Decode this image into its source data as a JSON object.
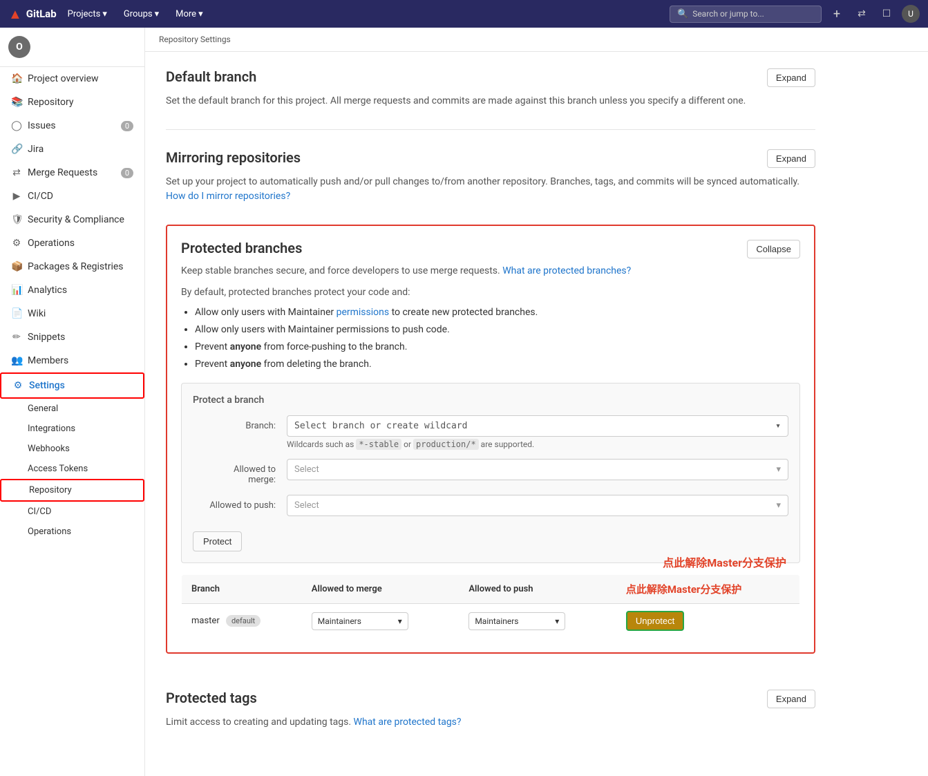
{
  "topnav": {
    "logo_text": "GitLab",
    "nav_items": [
      "Projects",
      "Groups",
      "More"
    ],
    "search_placeholder": "Search or jump to...",
    "icons": [
      "plus-icon",
      "merge-icon",
      "todo-icon",
      "user-icon"
    ]
  },
  "sidebar": {
    "avatar_initial": "O",
    "project_name": "",
    "items": [
      {
        "id": "project-overview",
        "label": "Project overview",
        "icon": "home-icon"
      },
      {
        "id": "repository",
        "label": "Repository",
        "icon": "book-icon"
      },
      {
        "id": "issues",
        "label": "Issues",
        "icon": "issues-icon",
        "badge": "0"
      },
      {
        "id": "jira",
        "label": "Jira",
        "icon": "jira-icon"
      },
      {
        "id": "merge-requests",
        "label": "Merge Requests",
        "icon": "merge-icon",
        "badge": "0"
      },
      {
        "id": "cicd",
        "label": "CI/CD",
        "icon": "cicd-icon"
      },
      {
        "id": "security-compliance",
        "label": "Security & Compliance",
        "icon": "shield-icon"
      },
      {
        "id": "operations",
        "label": "Operations",
        "icon": "ops-icon"
      },
      {
        "id": "packages-registries",
        "label": "Packages & Registries",
        "icon": "package-icon"
      },
      {
        "id": "analytics",
        "label": "Analytics",
        "icon": "analytics-icon"
      },
      {
        "id": "wiki",
        "label": "Wiki",
        "icon": "wiki-icon"
      },
      {
        "id": "snippets",
        "label": "Snippets",
        "icon": "snippet-icon"
      },
      {
        "id": "members",
        "label": "Members",
        "icon": "members-icon"
      },
      {
        "id": "settings",
        "label": "Settings",
        "icon": "settings-icon",
        "active": true,
        "highlighted": true
      }
    ],
    "sub_items": [
      {
        "id": "general",
        "label": "General"
      },
      {
        "id": "integrations",
        "label": "Integrations"
      },
      {
        "id": "webhooks",
        "label": "Webhooks"
      },
      {
        "id": "access-tokens",
        "label": "Access Tokens"
      },
      {
        "id": "repository",
        "label": "Repository",
        "active": true,
        "highlighted": true
      },
      {
        "id": "cicd",
        "label": "CI/CD"
      },
      {
        "id": "operations",
        "label": "Operations"
      }
    ]
  },
  "breadcrumb": {
    "items": [
      "Repository Settings"
    ]
  },
  "sections": {
    "default_branch": {
      "title": "Default branch",
      "desc": "Set the default branch for this project. All merge requests and commits are made against this branch unless you specify a different one.",
      "button": "Expand"
    },
    "mirroring": {
      "title": "Mirroring repositories",
      "desc": "Set up your project to automatically push and/or pull changes to/from another repository. Branches, tags, and commits will be synced automatically.",
      "link_text": "How do I mirror repositories?",
      "button": "Expand"
    },
    "protected_branches": {
      "title": "Protected branches",
      "button": "Collapse",
      "desc1": "Keep stable branches secure, and force developers to use merge requests.",
      "link_text1": "What are protected branches?",
      "desc2": "By default, protected branches protect your code and:",
      "bullets": [
        "Allow only users with Maintainer <link>permissions</link> to create new protected branches.",
        "Allow only users with Maintainer permissions to push code.",
        "Prevent <strong>anyone</strong> from force-pushing to the branch.",
        "Prevent <strong>anyone</strong> from deleting the branch."
      ],
      "protect_box": {
        "title": "Protect a branch",
        "branch_label": "Branch:",
        "branch_placeholder": "Select branch or create wildcard",
        "branch_hint": "Wildcards such as *-stable or production/* are supported.",
        "merge_label": "Allowed to merge:",
        "merge_placeholder": "Select",
        "push_label": "Allowed to push:",
        "push_placeholder": "Select",
        "protect_button": "Protect"
      },
      "table": {
        "headers": [
          "Branch",
          "Allowed to merge",
          "Allowed to push",
          ""
        ],
        "rows": [
          {
            "branch": "master",
            "badge": "default",
            "allowed_to_merge": "Maintainers",
            "allowed_to_push": "Maintainers",
            "action": "Unprotect"
          }
        ]
      },
      "annotation": "点此解除Master分支保护"
    },
    "protected_tags": {
      "title": "Protected tags",
      "button": "Expand",
      "desc": "Limit access to creating and updating tags.",
      "link_text": "What are protected tags?"
    }
  }
}
